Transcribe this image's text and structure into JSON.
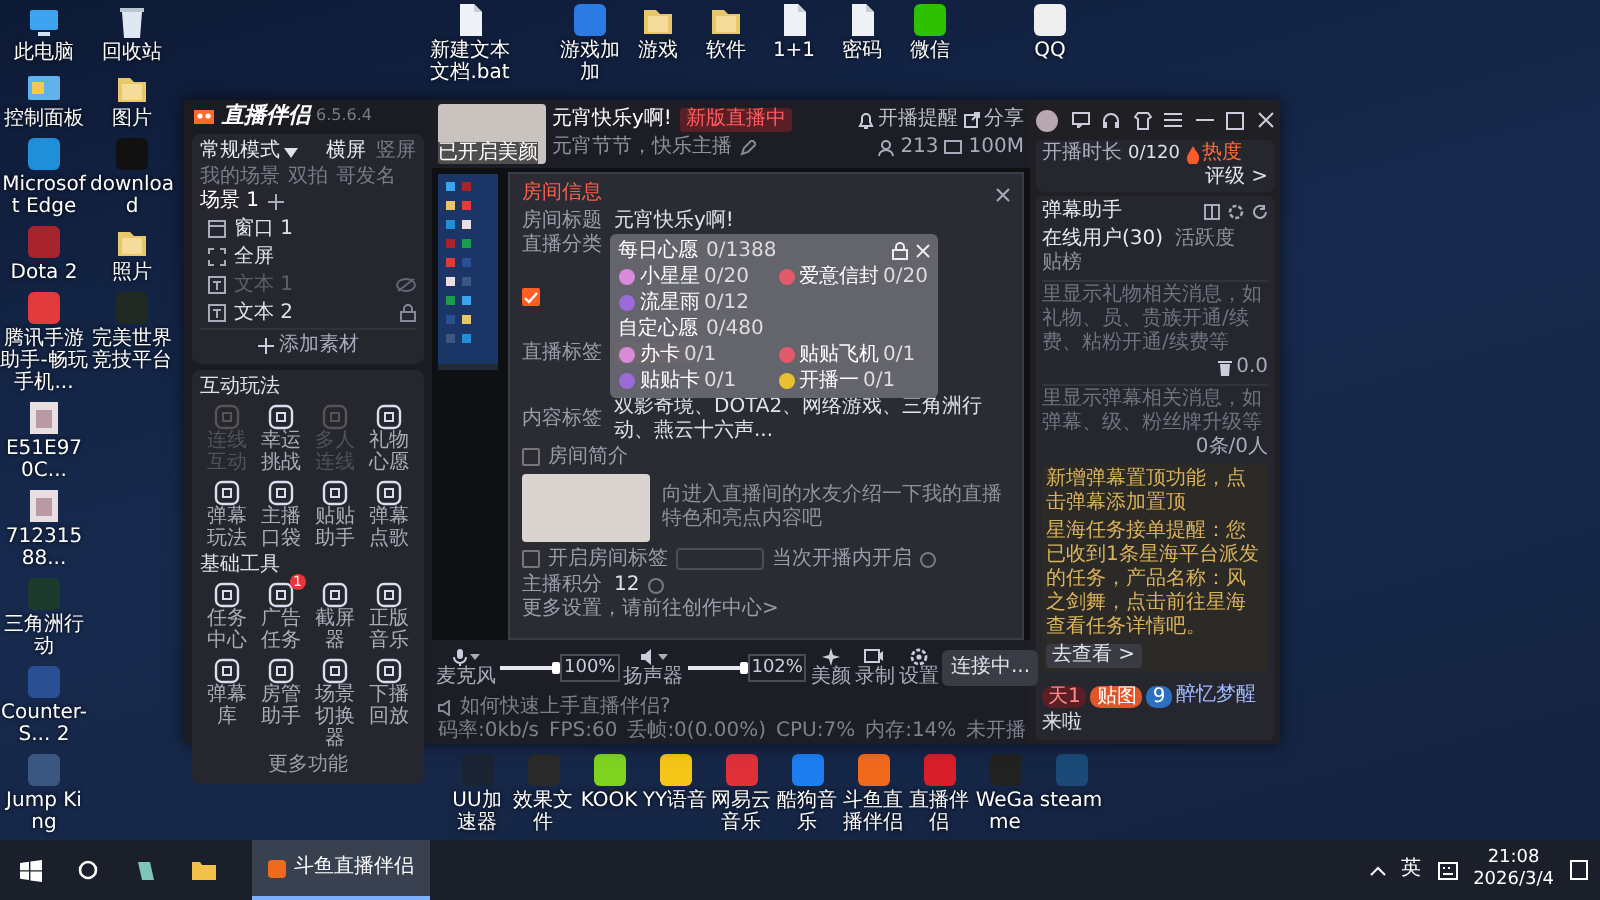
{
  "desktop": {
    "left_rows": [
      [
        {
          "label": "此电脑",
          "kind": "pc"
        },
        {
          "label": "回收站",
          "kind": "bin"
        }
      ],
      [
        {
          "label": "控制面板",
          "kind": "panel"
        },
        {
          "label": "图片",
          "kind": "folder"
        }
      ],
      [
        {
          "label": "Microsoft Edge",
          "kind": "app",
          "color": "#1f8fd8"
        },
        {
          "label": "download",
          "kind": "app",
          "color": "#111111"
        }
      ],
      [
        {
          "label": "Dota 2",
          "kind": "app",
          "color": "#a8242c"
        },
        {
          "label": "照片",
          "kind": "folder"
        }
      ],
      [
        {
          "label": "腾讯手游助手-畅玩手机...",
          "kind": "app",
          "color": "#e23b3b"
        },
        {
          "label": "完美世界竞技平台",
          "kind": "app",
          "color": "#202a22"
        }
      ],
      [
        {
          "label": "E51E970C...",
          "kind": "image"
        }
      ],
      [
        {
          "label": "71231588...",
          "kind": "image"
        }
      ],
      [
        {
          "label": "三角洲行动",
          "kind": "app",
          "color": "#1c3b2c"
        }
      ],
      [
        {
          "label": "Counter-S... 2",
          "kind": "app",
          "color": "#2b4f93"
        }
      ],
      [
        {
          "label": "Jump King",
          "kind": "app",
          "color": "#3b5680"
        }
      ]
    ],
    "top_row": [
      {
        "label": "新建文本文档.bat",
        "kind": "file"
      },
      {
        "label": "游戏加加",
        "kind": "app",
        "color": "#2c7be5"
      },
      {
        "label": "游戏",
        "kind": "folder"
      },
      {
        "label": "软件",
        "kind": "folder"
      },
      {
        "label": "1+1",
        "kind": "file"
      },
      {
        "label": "密码",
        "kind": "file"
      },
      {
        "label": "微信",
        "kind": "app",
        "color": "#2dc100"
      },
      {
        "label": "QQ",
        "kind": "app",
        "color": "#eeeeee"
      }
    ],
    "bottom_row": [
      {
        "label": "UU加速器",
        "kind": "app",
        "color": "#1b2433"
      },
      {
        "label": "效果文件",
        "kind": "app",
        "color": "#2a2a2a"
      },
      {
        "label": "KOOK",
        "kind": "app",
        "color": "#7ed321"
      },
      {
        "label": "YY语音",
        "kind": "app",
        "color": "#f5c518"
      },
      {
        "label": "网易云音乐",
        "kind": "app",
        "color": "#e0303a"
      },
      {
        "label": "酷狗音乐",
        "kind": "app",
        "color": "#1d7ef0"
      },
      {
        "label": "斗鱼直播伴侣",
        "kind": "app",
        "color": "#f06a1d"
      },
      {
        "label": "直播伴侣",
        "kind": "app",
        "color": "#d81e2a"
      },
      {
        "label": "WeGame",
        "kind": "app",
        "color": "#222222"
      },
      {
        "label": "steam",
        "kind": "app",
        "color": "#1b4a78"
      }
    ]
  },
  "app": {
    "logo": "直播伴侣",
    "version": "6.5.6.4",
    "mode": "常规模式",
    "orientations": [
      {
        "label": "横屏",
        "selected": true
      },
      {
        "label": "竖屏",
        "selected": false
      }
    ],
    "scene_tabs": [
      {
        "label": "我的场景",
        "selected": false
      },
      {
        "label": "双拍",
        "selected": false
      },
      {
        "label": "哥发名",
        "selected": false
      },
      {
        "label": "场景 1",
        "selected": true
      }
    ],
    "sources": [
      {
        "label": "窗口 1",
        "kind": "window",
        "visible": true,
        "locked": false
      },
      {
        "label": "全屏",
        "kind": "screen",
        "visible": true,
        "locked": false
      },
      {
        "label": "文本 1",
        "kind": "text",
        "visible": false,
        "locked": false
      },
      {
        "label": "文本 2",
        "kind": "text",
        "visible": true,
        "locked": true
      }
    ],
    "add_source": "添加素材",
    "sections": [
      {
        "title": "互动玩法",
        "tools": [
          {
            "label": "连线互动",
            "disabled": true
          },
          {
            "label": "幸运挑战",
            "disabled": false
          },
          {
            "label": "多人连线",
            "disabled": true
          },
          {
            "label": "礼物心愿",
            "disabled": false
          },
          {
            "label": "弹幕玩法",
            "disabled": false
          },
          {
            "label": "主播口袋",
            "disabled": false
          },
          {
            "label": "贴贴助手",
            "disabled": false
          },
          {
            "label": "弹幕点歌",
            "disabled": false
          }
        ]
      },
      {
        "title": "基础工具",
        "tools": [
          {
            "label": "任务中心",
            "disabled": false
          },
          {
            "label": "广告任务",
            "disabled": false,
            "badge": "1"
          },
          {
            "label": "截屏器",
            "disabled": false
          },
          {
            "label": "正版音乐",
            "disabled": false
          },
          {
            "label": "弹幕库",
            "disabled": false
          },
          {
            "label": "房管助手",
            "disabled": false
          },
          {
            "label": "场景切换器",
            "disabled": false
          },
          {
            "label": "下播回放",
            "disabled": false
          }
        ]
      }
    ],
    "more": "更多功能",
    "room": {
      "thumbnail_caption": "已开启美颜",
      "title": "元宵快乐y啊!",
      "status": "新版直播中",
      "subtitle": "元宵节节，快乐主播",
      "reminder": "开播提醒",
      "share": "分享",
      "viewers": "213",
      "bandwidth": "100M"
    },
    "dialog": {
      "title": "房间信息",
      "room_title_label": "房间标题",
      "room_title": "元宵快乐y啊!",
      "category_label": "直播分类",
      "category_checked": true,
      "tag_label": "直播标签",
      "content_tags_label": "内容标签",
      "content_tags": "双影奇境、DOTA2、网络游戏、三角洲行动、燕云十六声...",
      "intro_label": "房间简介",
      "intro_checked": false,
      "intro_hint": "向进入直播间的水友介绍一下我的直播特色和亮点内容吧",
      "room_tag_label": "开启房间标签",
      "room_tag_checked": false,
      "room_tag_note": "当次开播内开启",
      "points_label": "主播积分",
      "points": "12",
      "more_link": "更多设置，请前往创作中心>"
    },
    "wish": {
      "title": "每日心愿",
      "count": "0/1388",
      "gifts": [
        {
          "name": "小星星",
          "count": "0/20"
        },
        {
          "name": "爱意信封",
          "count": "0/20"
        },
        {
          "name": "流星雨",
          "count": "0/12"
        }
      ],
      "custom_title": "自定心愿",
      "custom_count": "0/480",
      "custom_gifts": [
        {
          "name": "办卡",
          "count": "0/1"
        },
        {
          "name": "贴贴飞机",
          "count": "0/1"
        },
        {
          "name": "贴贴卡",
          "count": "0/1"
        },
        {
          "name": "开播一",
          "count": "0/1"
        }
      ]
    },
    "controls": {
      "mic": {
        "label": "麦克风",
        "level": 1,
        "reading": "100%"
      },
      "speaker": {
        "label": "扬声器",
        "level": 1,
        "reading": "102%"
      },
      "beauty": "美颜",
      "record": "录制",
      "settings": "设置",
      "live_button": "连接中..."
    },
    "status_bar": {
      "help": "如何快速上手直播伴侣?",
      "stats": [
        "码率:0kb/s",
        "FPS:60",
        "丢帧:0(0.00%)",
        "CPU:7%",
        "内存:14%",
        "未开播"
      ]
    },
    "right": {
      "duration_label": "开播时长",
      "duration": "0/120",
      "heat": "热度",
      "rating": "评级 >",
      "assistant_title": "弹幕助手",
      "tabs": [
        {
          "label": "在线用户(30)",
          "selected": true
        },
        {
          "label": "活跃度",
          "selected": false
        },
        {
          "label": "贴榜",
          "selected": false
        }
      ],
      "gift_note": "里显示礼物相关消息，如礼物、员、贵族开通/续费、粘粉开通/续费等",
      "gift_value": "0.0",
      "danmu_note": "里显示弹幕相关消息，如弹幕、级、粉丝牌升级等",
      "danmu_count": "0条/0人",
      "notices": [
        "新增弹幕置顶功能，点击弹幕添加置顶",
        "星海任务接单提醒：您已收到1条星海平台派发的任务，产品名称：风之剑舞，点击前往星海查看任务详情吧。"
      ],
      "view_link": "去查看 >",
      "user_badges": [
        "天1",
        "贴图",
        "9"
      ],
      "user_name": "醉忆梦醒",
      "user_action": "来啦"
    }
  },
  "taskbar": {
    "app_button": "斗鱼直播伴侣",
    "ime": "英",
    "time": "21:08",
    "date": "2026/3/4"
  }
}
